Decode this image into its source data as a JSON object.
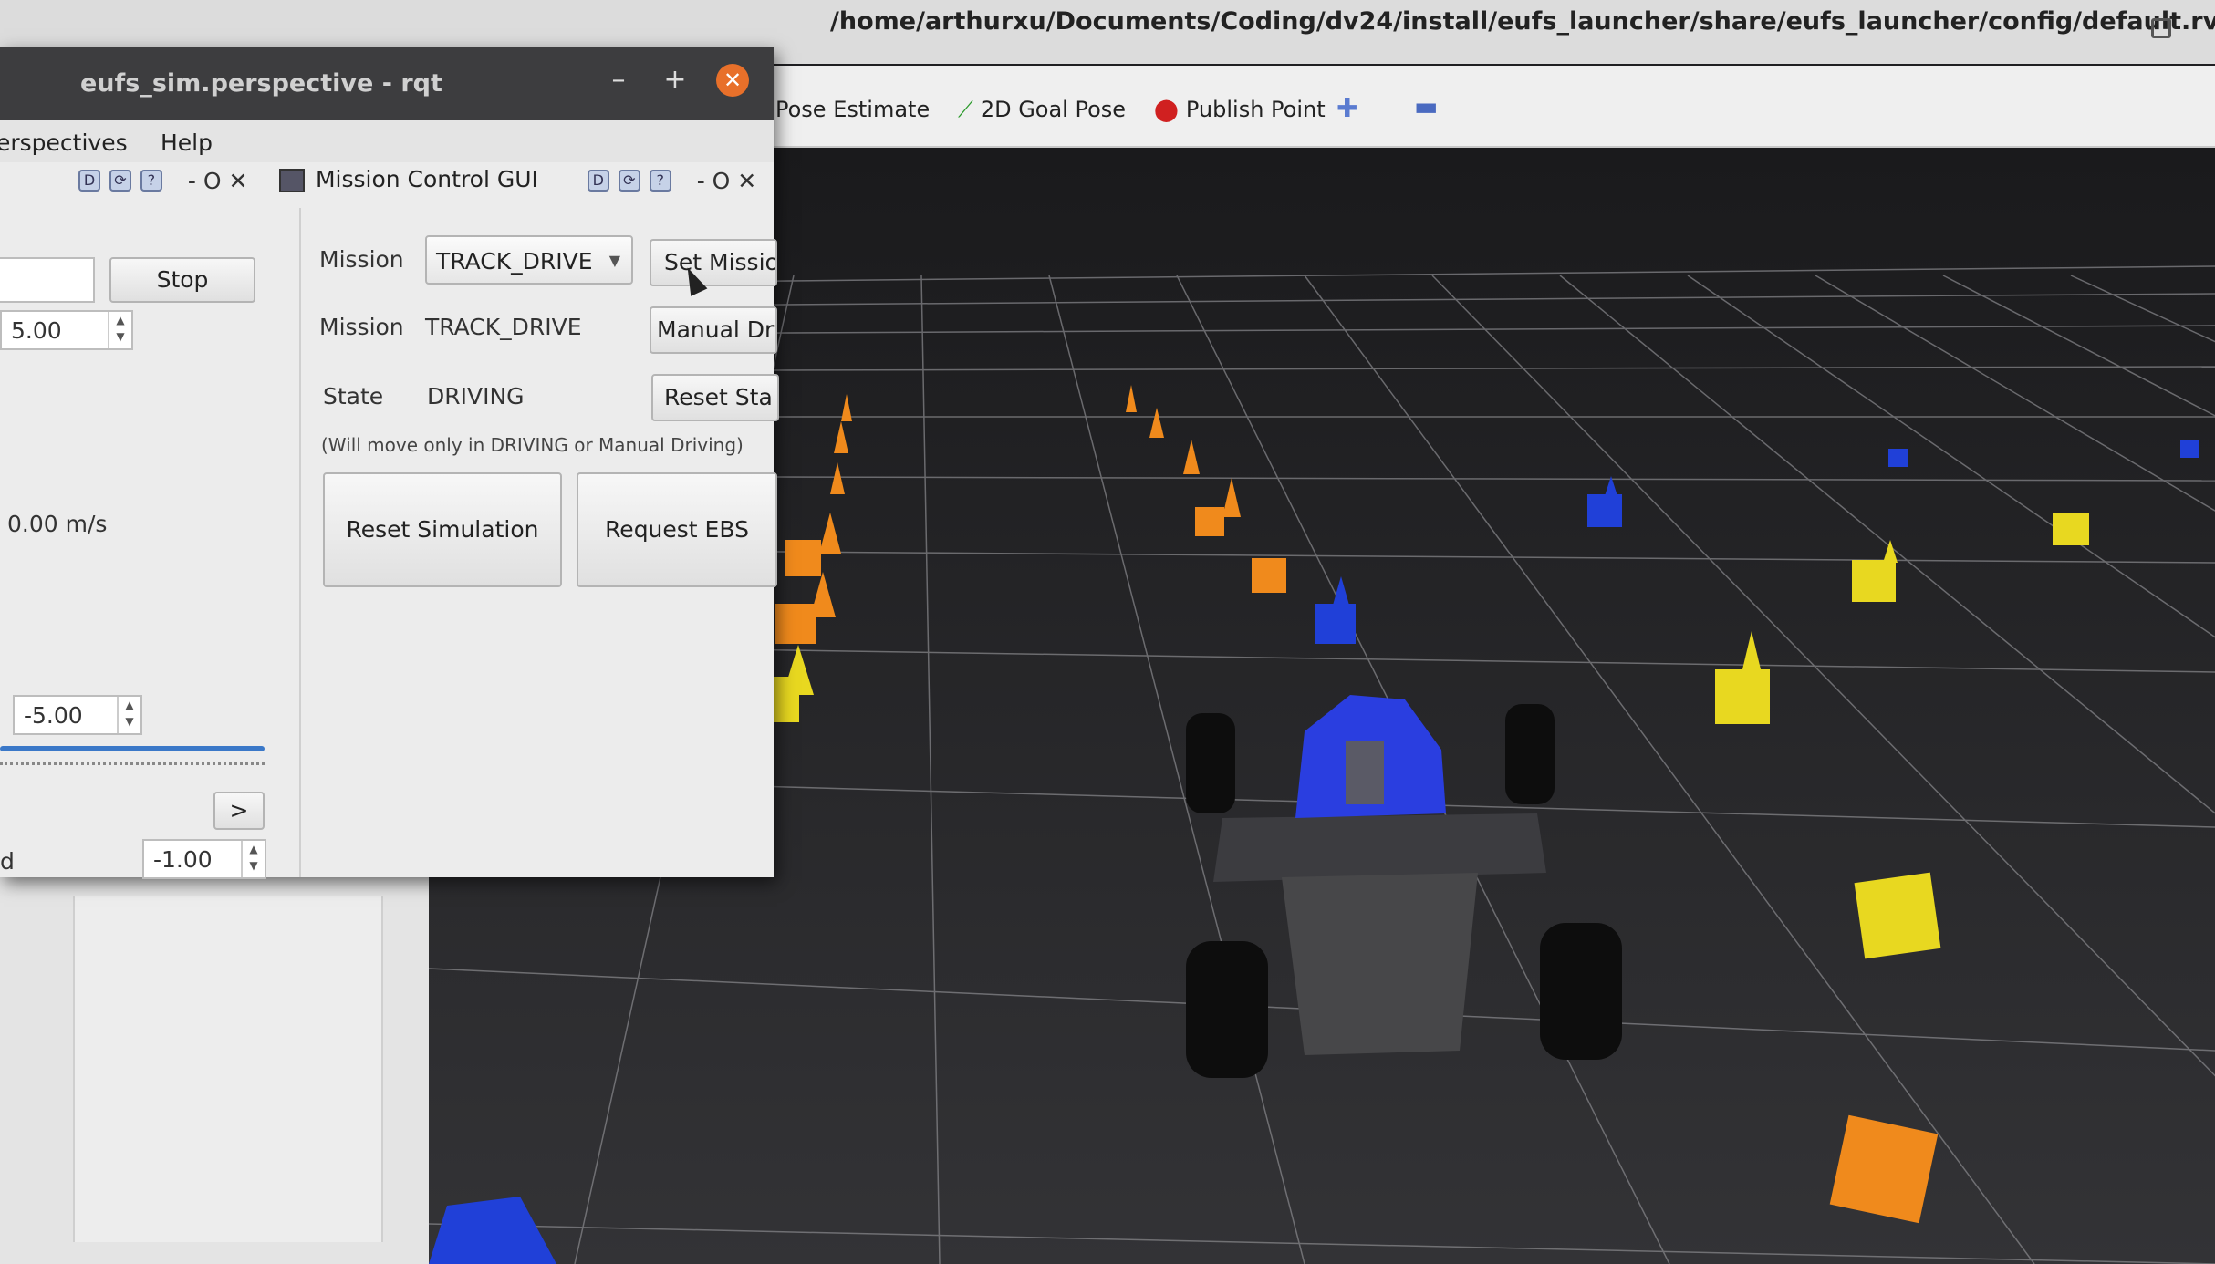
{
  "rviz": {
    "title": "/home/arthurxu/Documents/Coding/dv24/install/eufs_launcher/share/eufs_launcher/config/default.rviz* - RViz",
    "toolbar": {
      "pose_estimate": "Pose Estimate",
      "goal_pose": "2D Goal Pose",
      "publish_point": "Publish Point",
      "plus": "✚",
      "minus": "▬"
    }
  },
  "rqt": {
    "title": "eufs_sim.perspective - rqt",
    "menu": {
      "perspectives": "erspectives",
      "help": "Help"
    },
    "window_buttons": {
      "minimize": "–",
      "maximize": "+",
      "close": "✕"
    },
    "dock_left": {
      "icons": "D",
      "controls": "- O ✕"
    },
    "dock_right": {
      "title": "Mission Control GUI",
      "icons": "D",
      "controls": "- O ✕"
    },
    "left_panel": {
      "stop": "Stop",
      "speed_1": "5.00",
      "velocity": "0.00 m/s",
      "speed_2": "-5.00",
      "arrow": ">",
      "ad_label": "d",
      "speed_3": "-1.00",
      "slider_fraction": 1.0
    },
    "mission_control": {
      "mission_label": "Mission",
      "mission_selected": "TRACK_DRIVE",
      "set_mission": "Set Missio",
      "current_mission_label": "Mission",
      "current_mission": "TRACK_DRIVE",
      "manual_driving": "Manual Dri",
      "state_label": "State",
      "state_value": "DRIVING",
      "reset_state": "Reset Sta",
      "hint": "(Will move only in DRIVING or Manual Driving)",
      "reset_simulation": "Reset Simulation",
      "request_ebs": "Request EBS"
    }
  },
  "colors": {
    "accent_close": "#e8702a",
    "cone_orange": "#f08a1c",
    "cone_blue": "#2040d8",
    "cone_yellow": "#e8d820",
    "car_blue": "#2a3ee0"
  }
}
